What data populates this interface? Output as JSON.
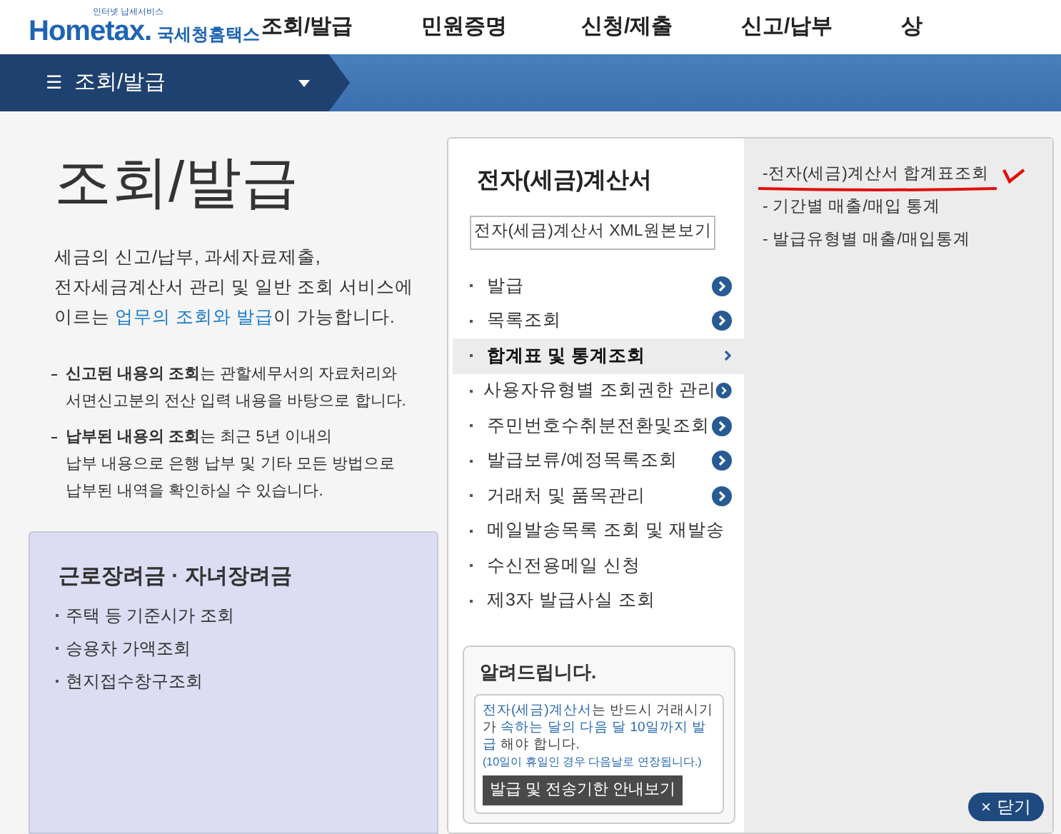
{
  "logo": {
    "tagline": "인터넷 납세서비스",
    "wordmark": "Hometax.",
    "korean": "국세청홈택스"
  },
  "top_menu": [
    "조회/발급",
    "민원증명",
    "신청/제출",
    "신고/납부",
    "상"
  ],
  "nav_bar": {
    "menu_symbol": "☰",
    "label": "조회/발급"
  },
  "intro": {
    "title": "조회/발급",
    "lines": [
      [
        {
          "text": "세금의 신고/납부, 과세자료제출,",
          "link": false
        }
      ],
      [
        {
          "text": "전자세금계산서 관리 및 일반 조회 서비스에",
          "link": false
        }
      ],
      [
        {
          "text": "이르는 ",
          "link": false
        },
        {
          "text": "업무의 조회와 발급",
          "link": true
        },
        {
          "text": "이 가능합니다.",
          "link": false
        }
      ]
    ],
    "notes": [
      "**신고된 내용의 조회**는 관할세무서의 자료처리와\n서면신고분의 전산 입력 내용을 바탕으로 합니다.",
      "**납부된 내용의 조회**는 최근 5년 이내의\n납부 내용으로 은행 납부 및 기타 모든 방법으로\n납부된 내역을 확인하실 수 있습니다."
    ]
  },
  "incentive_card": {
    "title": "근로장려금 · 자녀장려금",
    "items": [
      "주택 등 기준시가 조회",
      "승용차 가액조회",
      "현지접수창구조회"
    ]
  },
  "menu_panel": {
    "title": "전자(세금)계산서",
    "xml_button": "전자(세금)계산서 XML원본보기",
    "items": [
      {
        "label": "발급",
        "kind": "arrow",
        "selected": false
      },
      {
        "label": "목록조회",
        "kind": "arrow",
        "selected": false
      },
      {
        "label": "합계표 및 통계조회",
        "kind": "arrow",
        "selected": true
      },
      {
        "label": "사용자유형별 조회권한 관리",
        "kind": "arrow",
        "selected": false
      },
      {
        "label": "주민번호수취분전환및조회",
        "kind": "arrow",
        "selected": false
      },
      {
        "label": "발급보류/예정목록조회",
        "kind": "arrow",
        "selected": false
      },
      {
        "label": "거래처 및 품목관리",
        "kind": "arrow",
        "selected": false
      },
      {
        "label": "메일발송목록 조회 및 재발송",
        "kind": "plain",
        "selected": false
      },
      {
        "label": "수신전용메일 신청",
        "kind": "plain",
        "selected": false
      },
      {
        "label": "제3자 발급사실 조회",
        "kind": "plain",
        "selected": false
      }
    ],
    "sub_items": [
      {
        "label": "-전자(세금)계산서 합계표조회",
        "marked": true
      },
      {
        "label": "- 기간별 매출/매입 통계",
        "marked": false
      },
      {
        "label": "- 발급유형별 매출/매입통계",
        "marked": false
      }
    ],
    "notice": {
      "title": "알려드립니다.",
      "segments": [
        {
          "text": "전자(세금)계산서",
          "highlight": true
        },
        {
          "text": "는 반드시 거래시기가 ",
          "highlight": false
        },
        {
          "text": "속하는 달의 다음 달 10일까지 발급",
          "highlight": true
        },
        {
          "text": " 해야 합니다.",
          "highlight": false
        }
      ],
      "footnote": "(10일이 휴일인 경우 다음날로 연장됩니다.)",
      "button": "발급 및 전송기한 안내보기"
    },
    "close_button": {
      "symbol": "×",
      "label": "닫기"
    }
  }
}
